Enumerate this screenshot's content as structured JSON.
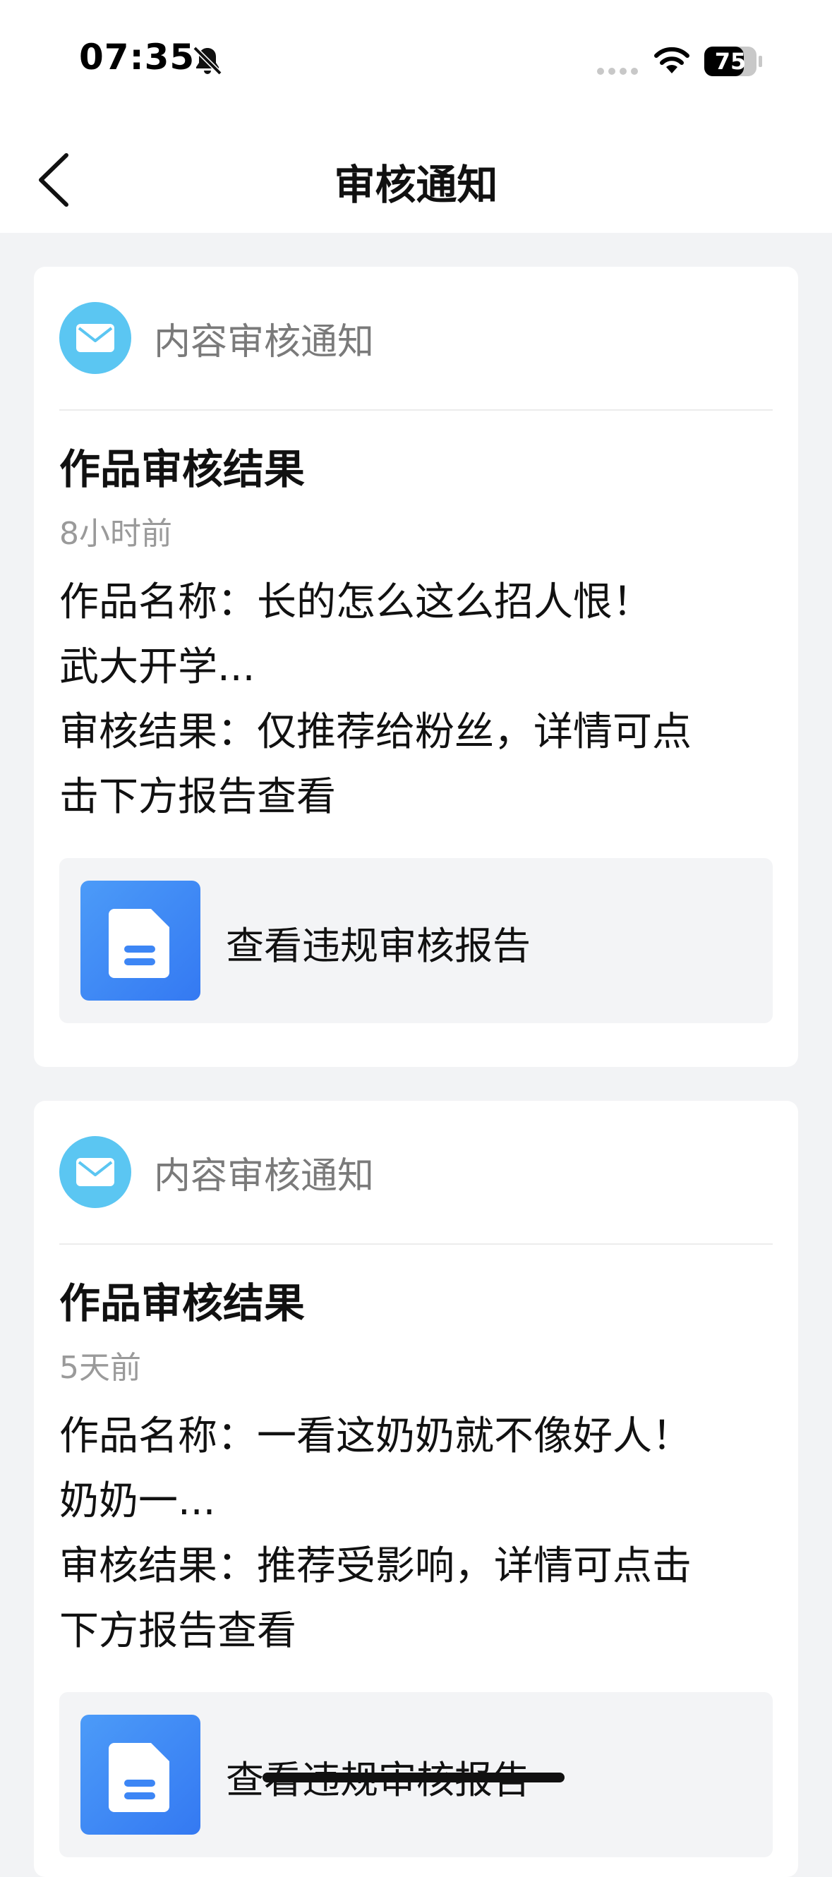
{
  "status_bar": {
    "time": "07:35",
    "battery": "75",
    "icons": [
      "bell-muted-icon",
      "cellular-signal-icon",
      "wifi-icon",
      "battery-icon"
    ]
  },
  "nav": {
    "title": "审核通知",
    "back_icon": "chevron-left-icon"
  },
  "notifications": [
    {
      "source": "内容审核通知",
      "title": "作品审核结果",
      "time": "8小时前",
      "lines": [
        "作品名称：长的怎么这么招人恨！",
        "武大开学...",
        "审核结果：仅推荐给粉丝，详情可点",
        "击下方报告查看"
      ],
      "report_label": "查看违规审核报告"
    },
    {
      "source": "内容审核通知",
      "title": "作品审核结果",
      "time": "5天前",
      "lines": [
        "作品名称：一看这奶奶就不像好人！",
        "奶奶一...",
        "审核结果：推荐受影响，详情可点击",
        "下方报告查看"
      ],
      "report_label": "查看违规审核报告"
    }
  ],
  "colors": {
    "mail_icon_bg": "#5bc6f2",
    "report_icon_bg": "#3d86f5",
    "page_bg": "#f2f3f5"
  }
}
